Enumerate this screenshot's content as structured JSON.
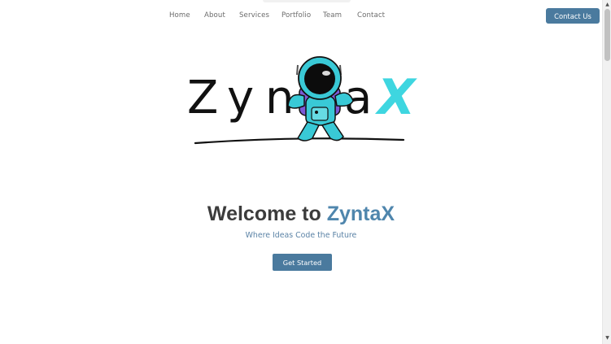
{
  "nav": {
    "items": [
      {
        "label": "Home"
      },
      {
        "label": "About"
      },
      {
        "label": "Services"
      },
      {
        "label": "Portfolio"
      },
      {
        "label": "Team"
      },
      {
        "label": "Contact"
      }
    ],
    "cta_label": "Contact Us"
  },
  "logo": {
    "letters": [
      "Z",
      "y",
      "n",
      "a"
    ],
    "accent_letter": "X",
    "brand": "ZyntaX"
  },
  "hero": {
    "title_prefix": "Welcome to",
    "title_accent": "ZyntaX",
    "subtitle": "Where Ideas Code the Future",
    "button_label": "Get Started"
  },
  "colors": {
    "accent": "#4a7a9e",
    "logo_cyan": "#3ed6e0",
    "astronaut_purple": "#7b5ad6"
  }
}
